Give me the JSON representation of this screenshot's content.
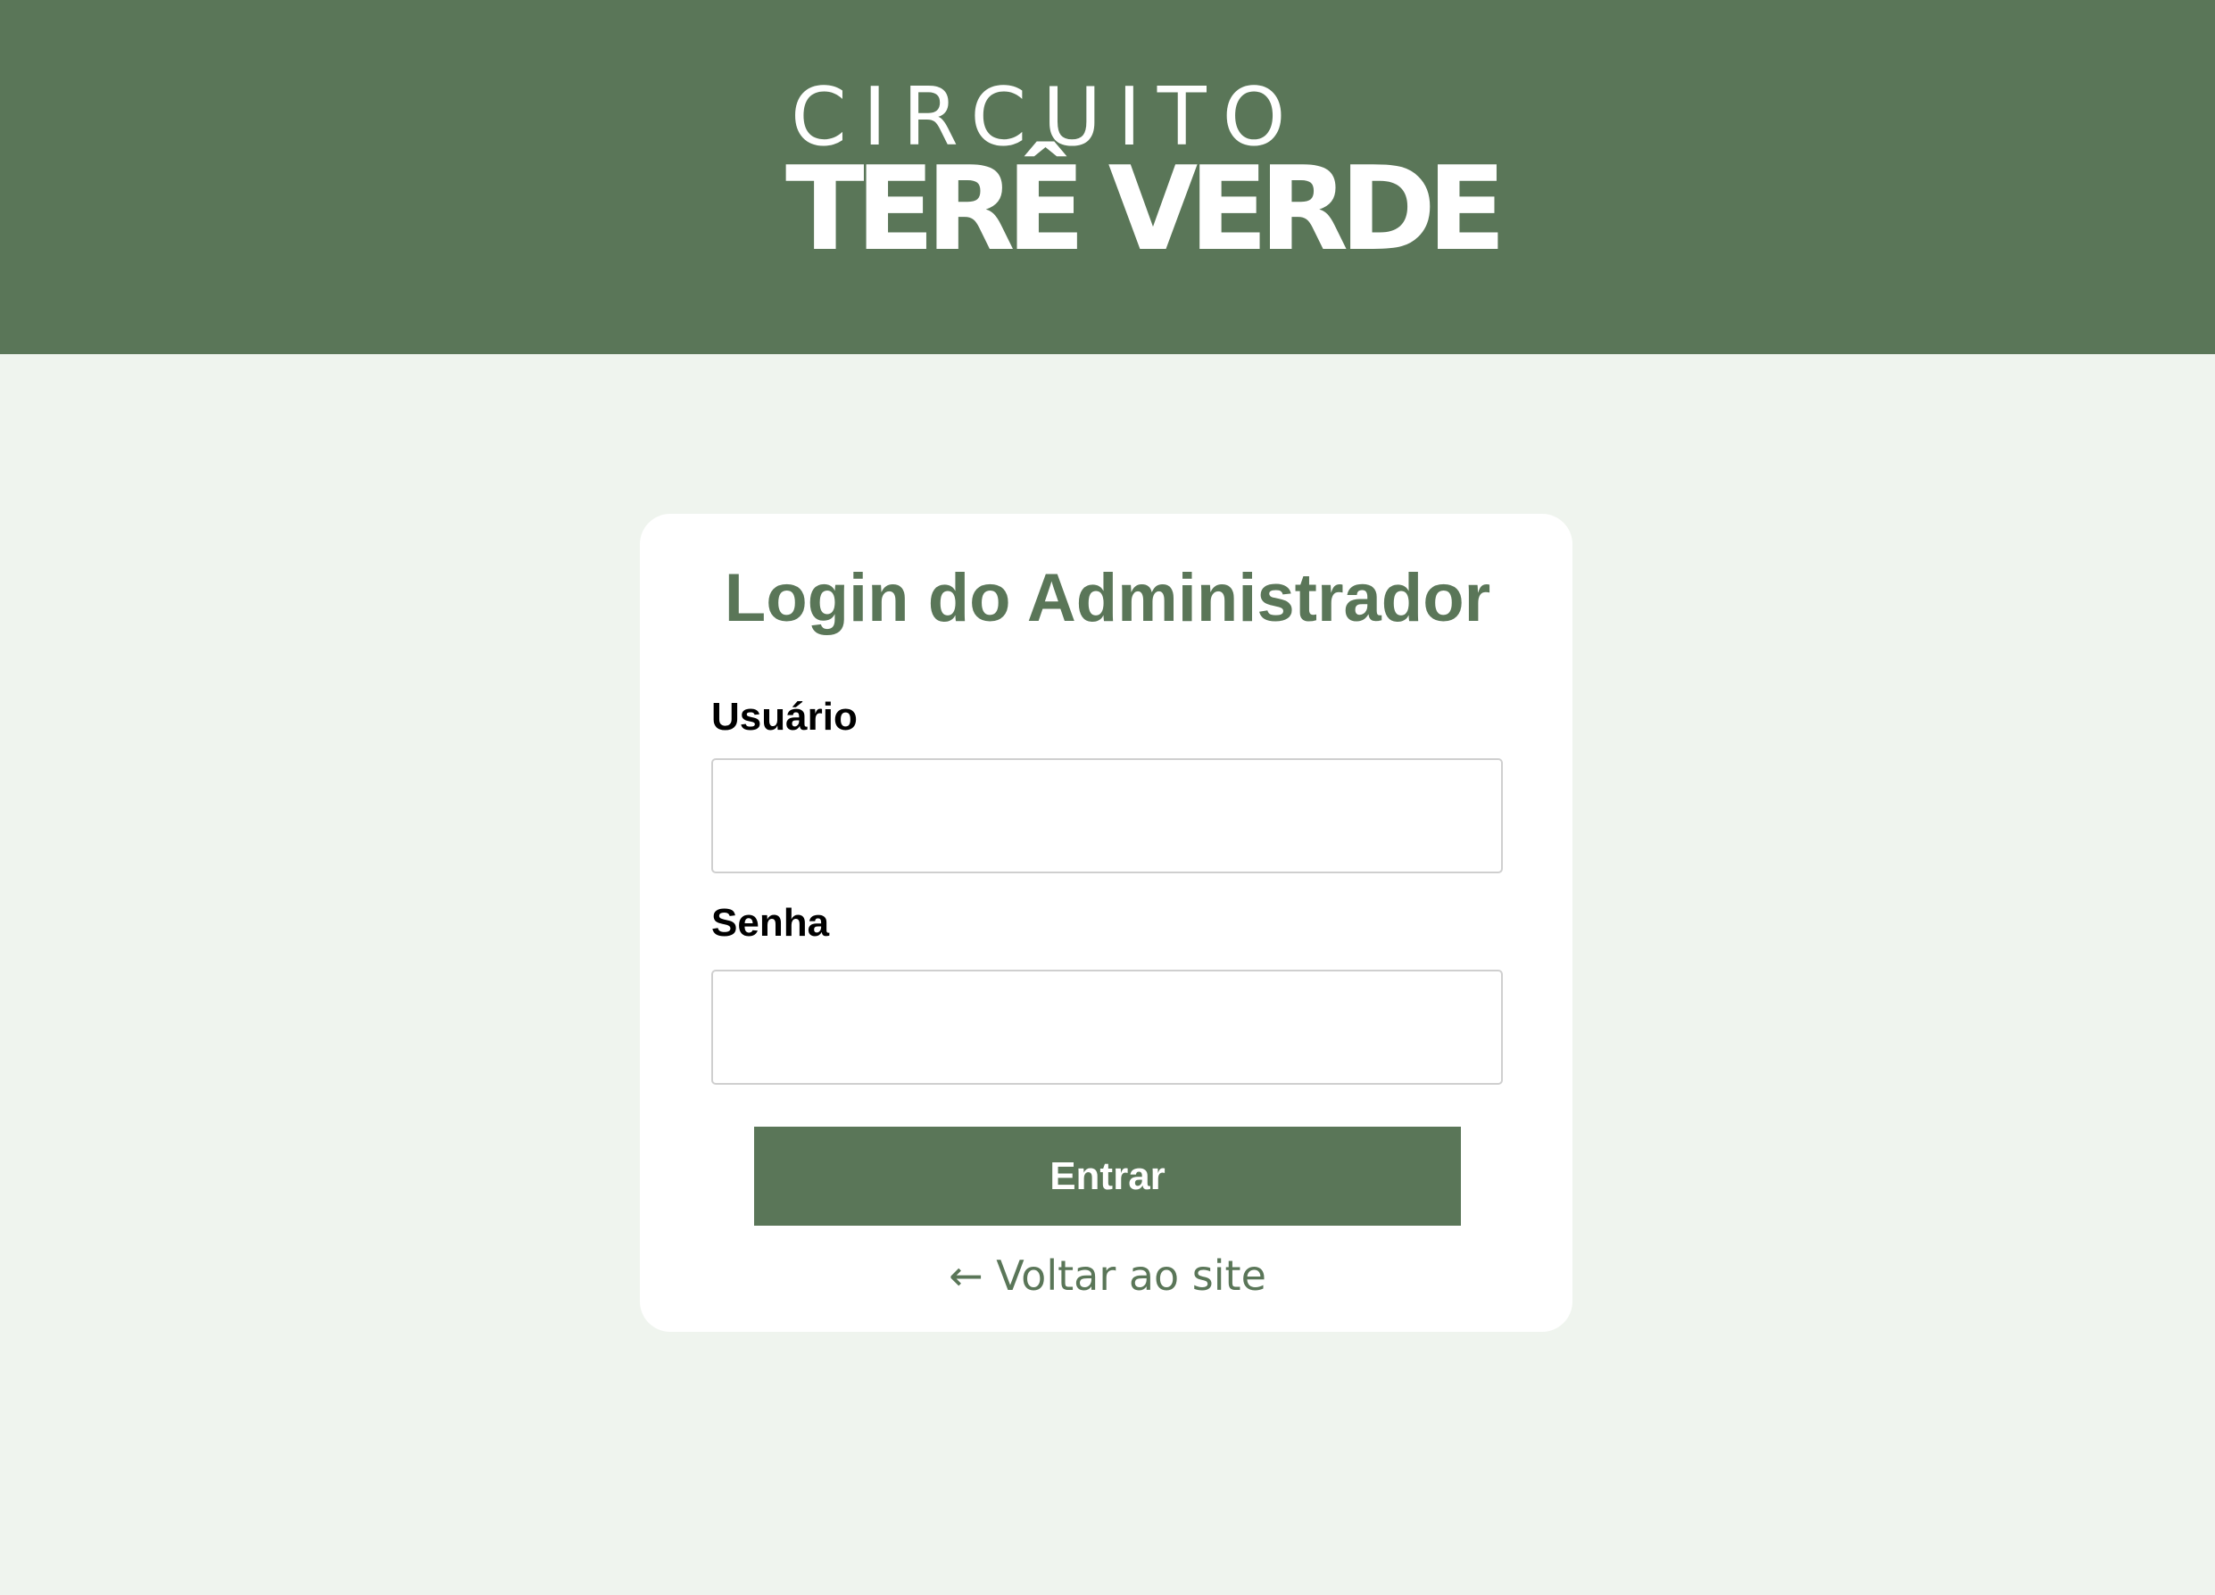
{
  "header": {
    "logo_line1": "CIRCUITO",
    "logo_line2": "TERÊ VERDE"
  },
  "login": {
    "title": "Login do Administrador",
    "username_label": "Usuário",
    "username_value": "",
    "password_label": "Senha",
    "password_value": "",
    "submit_label": "Entrar",
    "back_link": "← Voltar ao site"
  },
  "colors": {
    "brand_green": "#5a7658",
    "page_background": "#eff4ee",
    "card_background": "#ffffff"
  }
}
